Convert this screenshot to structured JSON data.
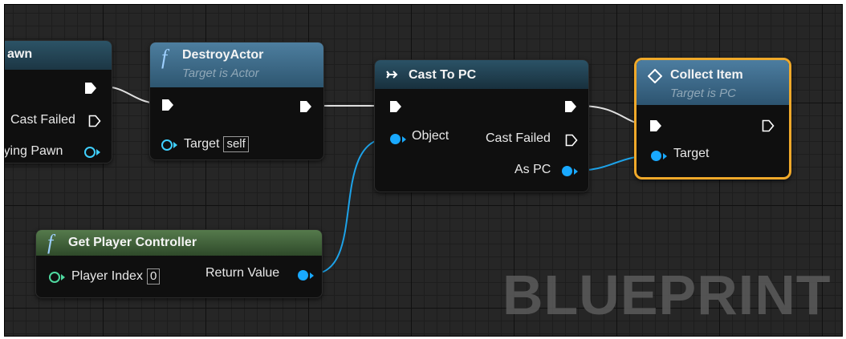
{
  "graph": {
    "watermark": "BLUEPRINT"
  },
  "nodes": {
    "pawn": {
      "title_fragment": "awn",
      "cast_failed": "Cast Failed",
      "pawn_out": "lying Pawn"
    },
    "destroy_actor": {
      "title": "DestroyActor",
      "subtitle": "Target is Actor",
      "target_label": "Target",
      "target_value": "self"
    },
    "cast_to_pc": {
      "title": "Cast To PC",
      "object_label": "Object",
      "cast_failed": "Cast Failed",
      "as_pc": "As PC"
    },
    "collect_item": {
      "title": "Collect Item",
      "subtitle": "Target is PC",
      "target_label": "Target"
    },
    "get_player_controller": {
      "title": "Get Player Controller",
      "player_index_label": "Player Index",
      "player_index_value": "0",
      "return_value": "Return Value"
    }
  },
  "colors": {
    "exec_pin": "#ffffff",
    "object_pin": "#19a9ff",
    "int_pin": "#4fd9a0",
    "selected_outline": "#f0a92a",
    "function_header": "#3d6a88",
    "cast_header": "#1f3b4c",
    "pure_function_header": "#3f6b37"
  },
  "icons": {
    "function": "function-icon",
    "cast": "cast-arrow-icon",
    "event": "diamond-icon"
  }
}
